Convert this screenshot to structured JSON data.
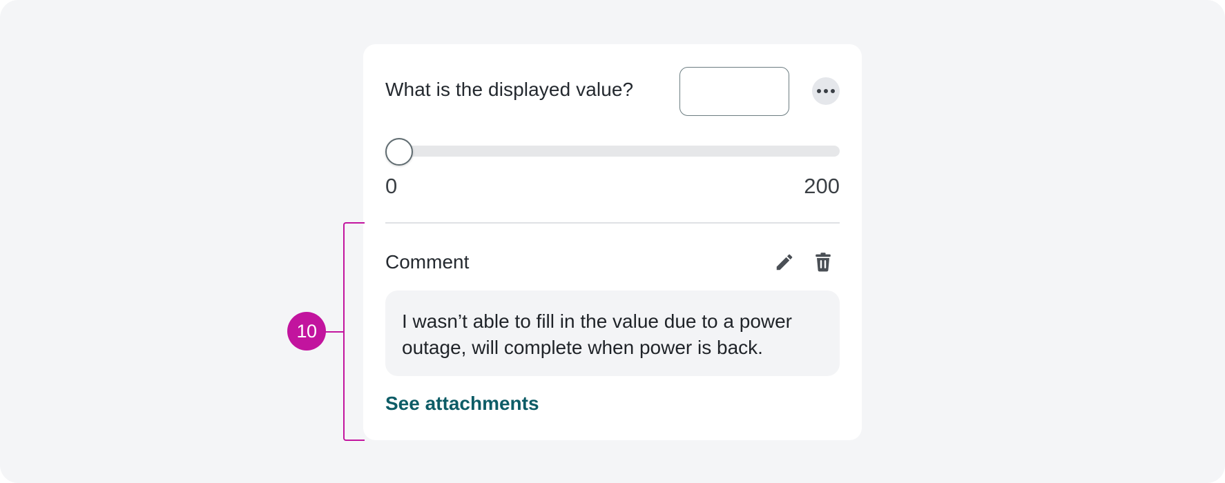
{
  "question": {
    "label": "What is the displayed value?",
    "input_value": "",
    "more_icon": "ellipsis-icon"
  },
  "slider": {
    "min_label": "0",
    "max_label": "200",
    "min": 0,
    "max": 200,
    "value": 0
  },
  "comment": {
    "label": "Comment",
    "edit_icon": "pencil-icon",
    "delete_icon": "trash-icon",
    "text": "I wasn’t able to fill in the value due to a power outage, will complete when power is back.",
    "attachments_link": "See attachments"
  },
  "annotation": {
    "callout_number": "10",
    "color": "#c2149e"
  },
  "colors": {
    "link": "#0d5c66",
    "background": "#f4f5f7"
  }
}
